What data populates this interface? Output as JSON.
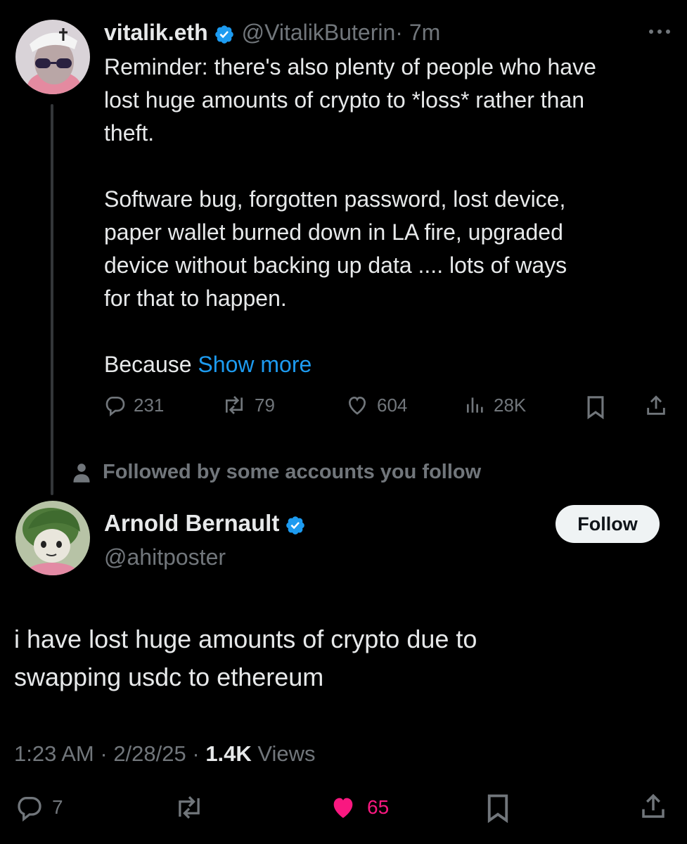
{
  "original_tweet": {
    "author_name": "vitalik.eth",
    "author_handle": "@VitalikButerin",
    "time_ago": "· 7m",
    "text": "Reminder: there's also plenty of people who have\nlost huge amounts of crypto to *loss* rather than\ntheft.\n\nSoftware bug, forgotten password, lost device,\npaper wallet burned down in LA fire, upgraded\ndevice without backing up data .... lots of ways\nfor that to happen.\n\nBecause ",
    "show_more_label": "Show more",
    "stats": {
      "replies": "231",
      "reposts": "79",
      "likes": "604",
      "views": "28K"
    }
  },
  "social_context": "Followed by some accounts you follow",
  "reply_tweet": {
    "author_name": "Arnold Bernault",
    "author_handle": "@ahitposter",
    "follow_label": "Follow",
    "text": "i have lost huge amounts of crypto due to\nswapping usdc to ethereum",
    "time": "1:23 AM",
    "date": "2/28/25",
    "views_count": "1.4K",
    "views_label": "Views",
    "stats": {
      "replies": "7",
      "likes": "65"
    }
  },
  "colors": {
    "background": "#000000",
    "text": "#e7e9ea",
    "secondary": "#71767b",
    "link": "#1d9bf0",
    "verified": "#1d9bf0",
    "like_active": "#f91880"
  },
  "icons": [
    "verified-badge-icon",
    "more-icon",
    "reply-icon",
    "repost-icon",
    "like-icon",
    "views-icon",
    "bookmark-icon",
    "share-icon",
    "person-icon"
  ]
}
